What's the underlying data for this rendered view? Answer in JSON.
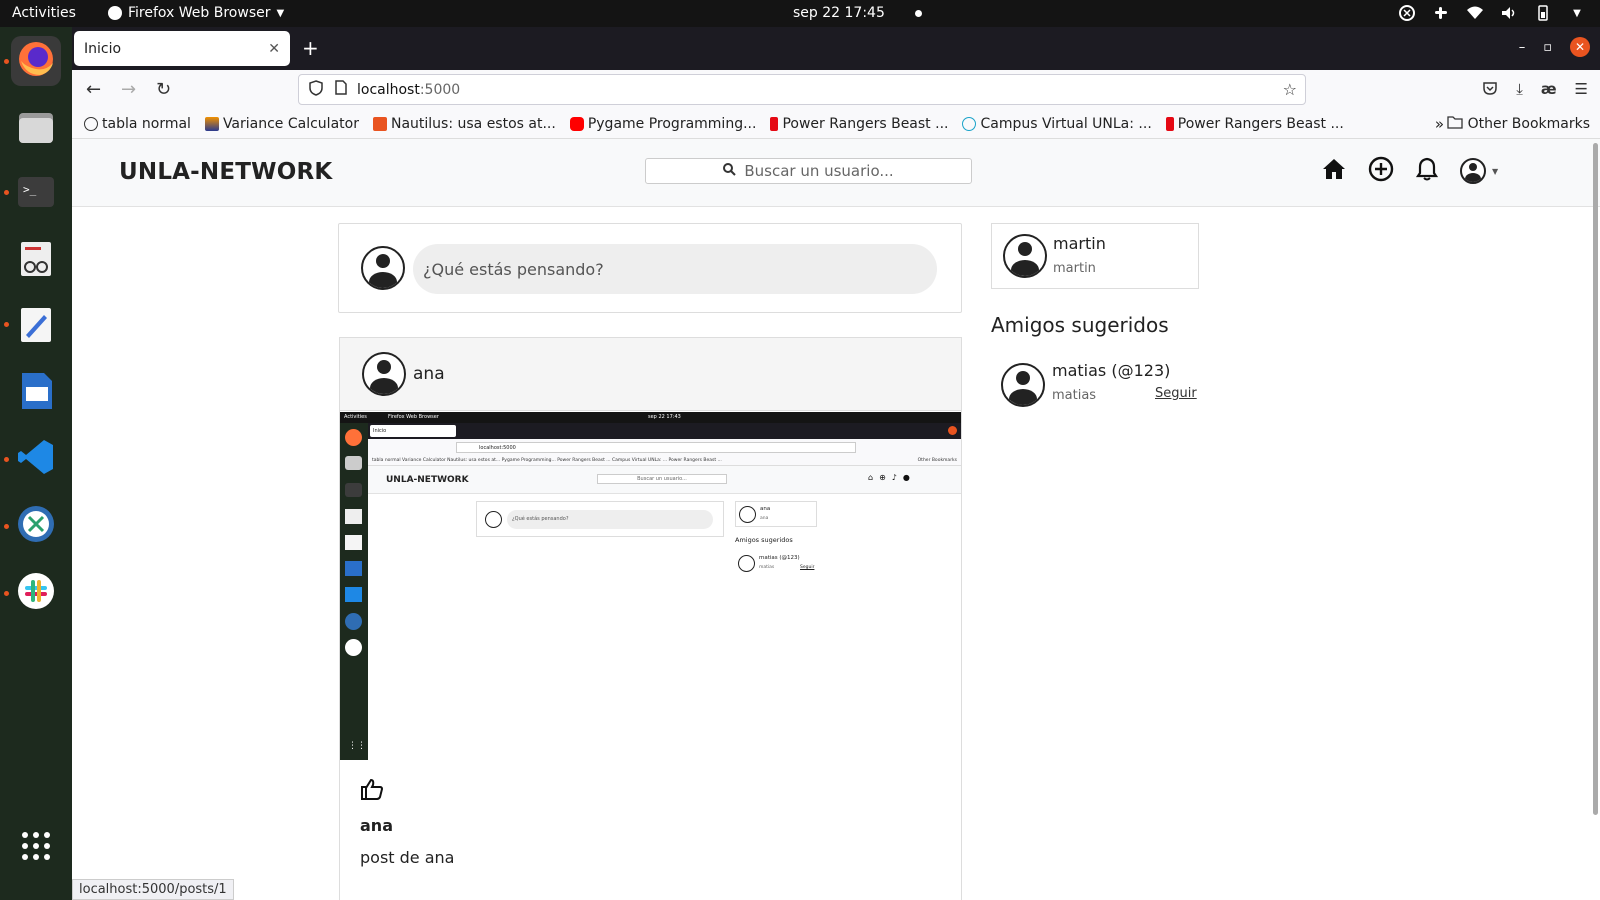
{
  "system": {
    "activities": "Activities",
    "app_menu": "Firefox Web Browser",
    "clock": "sep 22  17:45"
  },
  "browser": {
    "tab_title": "Inicio",
    "url_host": "localhost",
    "url_port": ":5000",
    "bookmarks": [
      {
        "label": "tabla normal"
      },
      {
        "label": "Variance Calculator"
      },
      {
        "label": "Nautilus: usa estos at..."
      },
      {
        "label": "Pygame Programming..."
      },
      {
        "label": "Power Rangers Beast ..."
      },
      {
        "label": "Campus Virtual UNLa: ..."
      },
      {
        "label": "Power Rangers Beast ..."
      }
    ],
    "other_bookmarks": "Other Bookmarks",
    "status_url": "localhost:5000/posts/1"
  },
  "site": {
    "brand": "UNLA-NETWORK",
    "search_placeholder": "Buscar un usuario...",
    "compose_placeholder": "¿Qué estás pensando?",
    "post": {
      "author": "ana",
      "user": "ana",
      "body": "post de ana"
    },
    "profile": {
      "name": "martin",
      "username": "martin"
    },
    "suggested_title": "Amigos sugeridos",
    "suggested": [
      {
        "name": "matias (@123)",
        "username": "matias",
        "follow": "Seguir"
      }
    ]
  },
  "nested_screenshot": {
    "activities": "Activities",
    "app_menu": "Firefox Web Browser",
    "clock": "sep 22  17:43",
    "tab_title": "Inicio",
    "url": "localhost:5000",
    "brand": "UNLA-NETWORK",
    "search": "Buscar un usuario...",
    "compose": "¿Qué estás pensando?",
    "profile_name": "ana",
    "profile_user": "ana",
    "suggested_title": "Amigos sugeridos",
    "sugg_name": "matias (@123)",
    "sugg_user": "matias",
    "sugg_follow": "Seguir",
    "bookmarks": "tabla normal  Variance Calculator  Nautilus: usa estos at...  Pygame Programming...  Power Rangers Beast ...  Campus Virtual UNLa: ...  Power Rangers Beast ...",
    "other_bookmarks": "Other Bookmarks"
  },
  "colors": {
    "accent": "#e95420",
    "topbar": "#141414",
    "tabbar": "#1c1b22"
  }
}
